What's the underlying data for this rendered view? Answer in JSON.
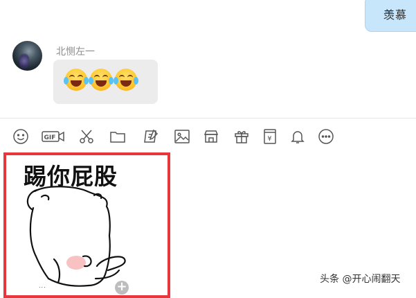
{
  "conversation": {
    "outgoing_message": "羡慕",
    "incoming": {
      "sender_name": "北恻左一",
      "emojis": [
        "face-with-tears-of-joy",
        "face-with-tears-of-joy",
        "face-with-tears-of-joy"
      ]
    }
  },
  "toolbar": {
    "buttons": [
      {
        "icon": "smiley-icon"
      },
      {
        "icon": "gif-icon"
      },
      {
        "icon": "scissors-icon"
      },
      {
        "icon": "folder-icon"
      },
      {
        "icon": "document-edit-icon"
      },
      {
        "icon": "image-icon"
      },
      {
        "icon": "shop-icon"
      },
      {
        "icon": "gift-icon"
      },
      {
        "icon": "red-packet-icon"
      },
      {
        "icon": "bell-icon"
      },
      {
        "icon": "more-icon"
      }
    ],
    "gif_label": "GIF",
    "yen_label": "¥"
  },
  "sticker_panel": {
    "sticker_title": "踢你屁股",
    "sticker_caption": "..."
  },
  "watermark": "头条 @开心闹翻天",
  "colors": {
    "outgoing_bubble": "#c7e6fb",
    "incoming_bubble": "#ececec",
    "highlight_border": "#e8373c"
  }
}
